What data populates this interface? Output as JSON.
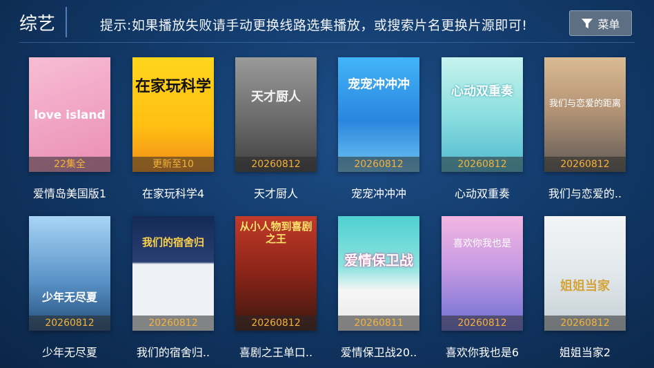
{
  "header": {
    "title": "综艺",
    "hint": "提示:如果播放失败请手动更换线路选集播放，或搜索片名更换片源即可!",
    "menu_label": "菜单",
    "menu_icon": "filter-icon"
  },
  "items": [
    {
      "title": "爱情岛美国版1",
      "status": "22集全",
      "poster_text": "love island",
      "colors": [
        "#f3a7c5",
        "#e98bb4"
      ]
    },
    {
      "title": "在家玩科学4",
      "status": "更新至10",
      "poster_text": "在家玩科学",
      "colors": [
        "#ffd21a",
        "#f08b1a"
      ]
    },
    {
      "title": "天才厨人",
      "status": "20260812",
      "poster_text": "天才厨人",
      "colors": [
        "#8c8c8c",
        "#4d4d4d"
      ]
    },
    {
      "title": "宠宠冲冲冲",
      "status": "20260812",
      "poster_text": "宠宠冲冲冲",
      "colors": [
        "#39a8f2",
        "#1c6fd0"
      ]
    },
    {
      "title": "心动双重奏",
      "status": "20260812",
      "poster_text": "心动双重奏",
      "colors": [
        "#b9f0ea",
        "#5ac8d6"
      ]
    },
    {
      "title": "我们与恋爱的..",
      "status": "20260812",
      "poster_text": "我们与恋爱的距离",
      "colors": [
        "#c9aa86",
        "#7b6a5a"
      ]
    },
    {
      "title": "少年无尽夏",
      "status": "20260812",
      "poster_text": "少年无尽夏",
      "colors": [
        "#8fc4f0",
        "#2b5d8f"
      ]
    },
    {
      "title": "我们的宿舍归..",
      "status": "20260812",
      "poster_text": "我们的宿舍归",
      "colors": [
        "#1b2f5b",
        "#e9eef4"
      ]
    },
    {
      "title": "喜剧之王单口..",
      "status": "20260812",
      "poster_text": "从小人物到喜剧之王",
      "colors": [
        "#b82d22",
        "#3a1912"
      ]
    },
    {
      "title": "爱情保卫战20..",
      "status": "20260811",
      "poster_text": "爱情保卫战",
      "colors": [
        "#3cc3c7",
        "#f3f3f3"
      ]
    },
    {
      "title": "喜欢你我也是6",
      "status": "20260812",
      "poster_text": "喜欢你我也是",
      "colors": [
        "#e9a3d7",
        "#7e6fd6"
      ]
    },
    {
      "title": "姐姐当家2",
      "status": "20260812",
      "poster_text": "姐姐当家",
      "colors": [
        "#eef1f3",
        "#c8d2d8"
      ]
    }
  ]
}
